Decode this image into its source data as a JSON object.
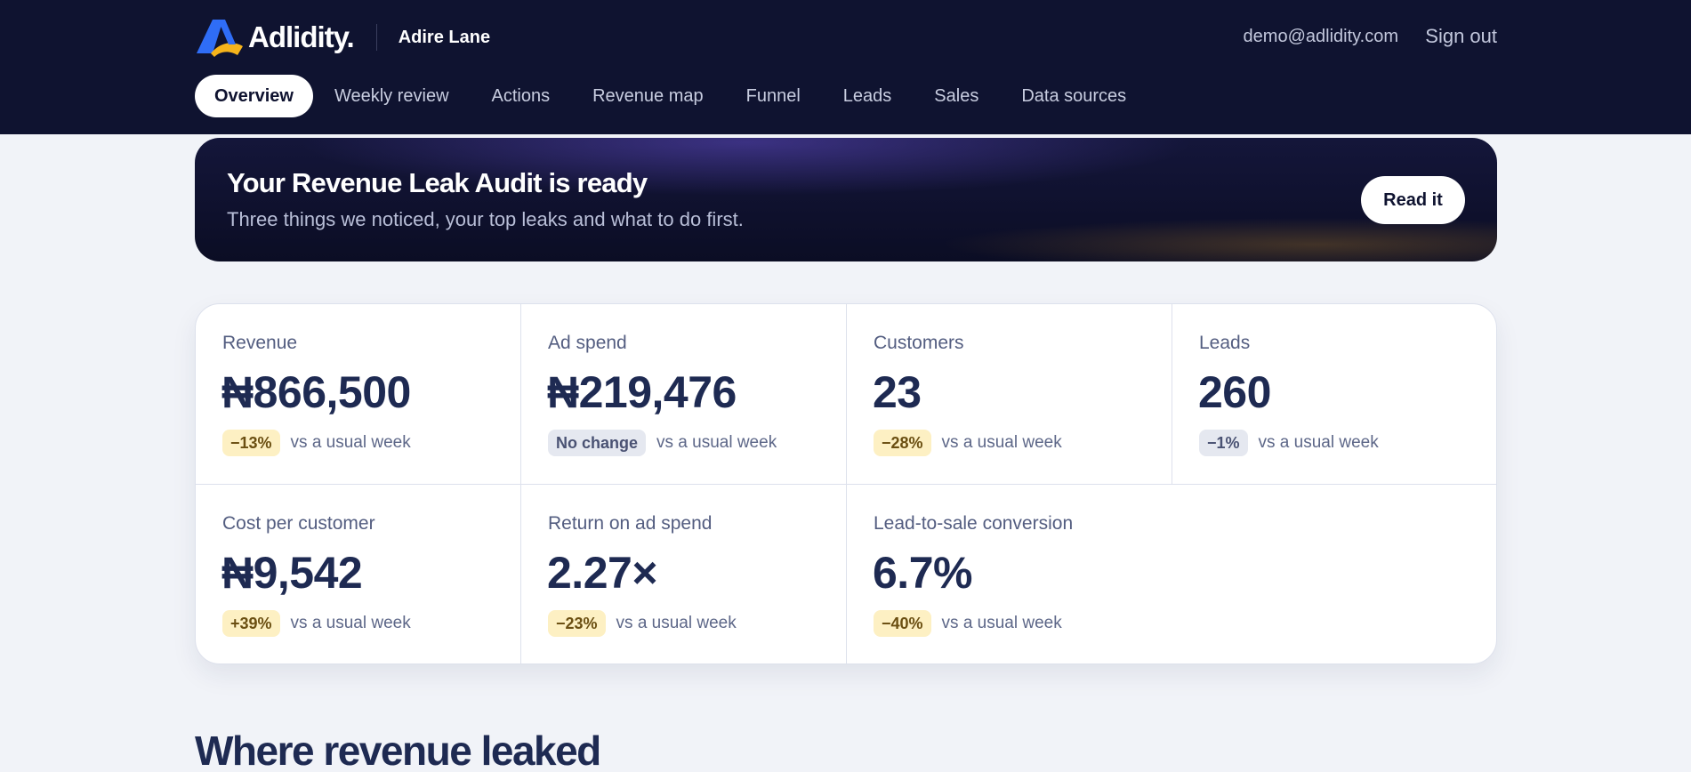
{
  "header": {
    "brand": "Adlidity.",
    "workspace": "Adire Lane",
    "user_email": "demo@adlidity.com",
    "sign_out": "Sign out"
  },
  "nav": [
    "Overview",
    "Weekly review",
    "Actions",
    "Revenue map",
    "Funnel",
    "Leads",
    "Sales",
    "Data sources"
  ],
  "banner": {
    "title": "Your Revenue Leak Audit is ready",
    "subtitle": "Three things we noticed, your top leaks and what to do first.",
    "button": "Read it"
  },
  "metrics": [
    {
      "label": "Revenue",
      "value": "₦866,500",
      "change": "−13%",
      "status": "warn",
      "compare": "vs a usual week"
    },
    {
      "label": "Ad spend",
      "value": "₦219,476",
      "change": "No change",
      "status": "neutral",
      "compare": "vs a usual week"
    },
    {
      "label": "Customers",
      "value": "23",
      "change": "−28%",
      "status": "warn",
      "compare": "vs a usual week"
    },
    {
      "label": "Leads",
      "value": "260",
      "change": "−1%",
      "status": "neutral",
      "compare": "vs a usual week"
    },
    {
      "label": "Cost per customer",
      "value": "₦9,542",
      "change": "+39%",
      "status": "warn",
      "compare": "vs a usual week"
    },
    {
      "label": "Return on ad spend",
      "value": "2.27×",
      "change": "−23%",
      "status": "warn",
      "compare": "vs a usual week"
    },
    {
      "label": "Lead-to-sale conversion",
      "value": "6.7%",
      "change": "−40%",
      "status": "warn",
      "compare": "vs a usual week"
    }
  ],
  "section": {
    "title": "Where revenue leaked"
  },
  "colors": {
    "header_bg": "#0f1330",
    "page_bg": "#f1f3f8",
    "text_primary": "#1e2a52",
    "pill_warn_bg": "#fdf0c3",
    "pill_neutral_bg": "#e5e8f0",
    "logo_blue": "#2f6df6",
    "logo_yellow": "#f6b41b"
  },
  "icons": {
    "logo": "adlidity-logo-icon"
  }
}
